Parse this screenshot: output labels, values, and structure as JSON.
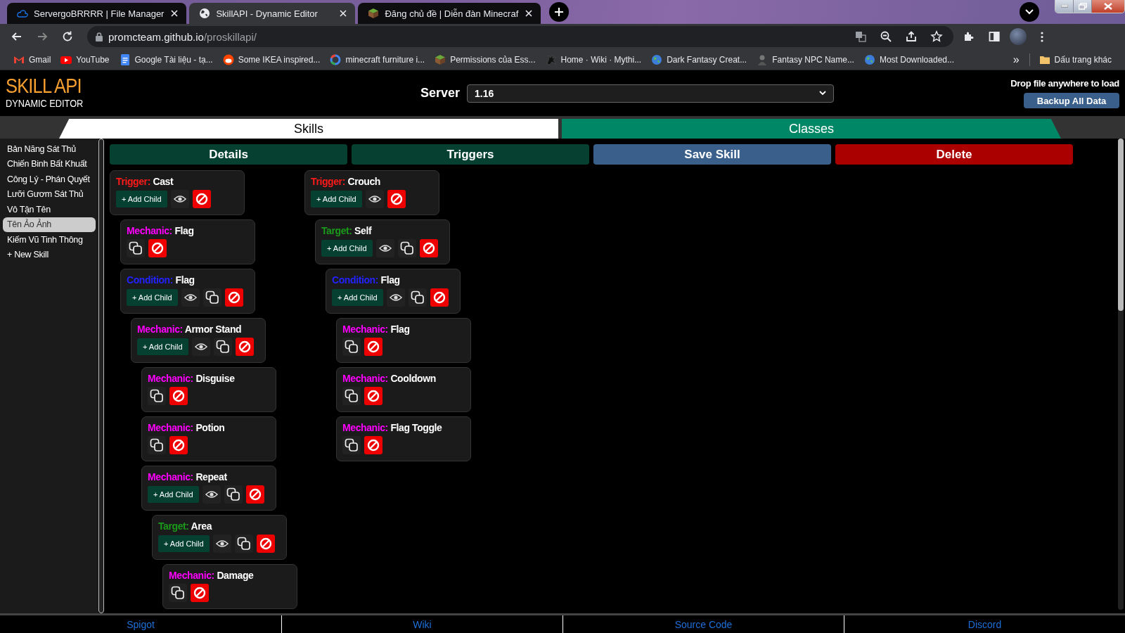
{
  "browser": {
    "tabs": [
      {
        "title": "ServergoBRRRR | File Manager",
        "selected": false
      },
      {
        "title": "SkillAPI - Dynamic Editor",
        "selected": true
      },
      {
        "title": "Đăng chủ đề | Diễn đàn Minecraf",
        "selected": false
      }
    ],
    "address": {
      "host": "promcteam.github.io",
      "path": "/proskillapi/"
    },
    "bookmarks": [
      "Gmail",
      "YouTube",
      "Google Tài liệu - tạ...",
      "Some IKEA inspired...",
      "minecraft furniture i...",
      "Permissions của Ess...",
      "Home · Wiki · Mythi...",
      "Dark Fantasy Creat...",
      "Fantasy NPC Name...",
      "Most Downloaded..."
    ],
    "overflow": "»",
    "other_bookmarks": "Dấu trang khác"
  },
  "header": {
    "logo_title": "SKILL API",
    "logo_subtitle": "DYNAMIC EDITOR",
    "server_label": "Server",
    "server_value": "1.16",
    "drop_hint": "Drop file anywhere to load",
    "backup_button": "Backup All Data"
  },
  "main_tabs": [
    {
      "label": "Skills",
      "selected": true
    },
    {
      "label": "Classes",
      "selected": false
    }
  ],
  "sidebar": {
    "items": [
      {
        "label": "Bản Năng Sát Thủ",
        "selected": false
      },
      {
        "label": "Chiến Binh Bất Khuất",
        "selected": false
      },
      {
        "label": "Công Lý - Phán Quyết",
        "selected": false
      },
      {
        "label": "Lưỡi Gươm Sát Thủ",
        "selected": false
      },
      {
        "label": "Vô Tận Tên",
        "selected": false
      },
      {
        "label": "Tên Ảo Ảnh",
        "selected": true
      },
      {
        "label": "Kiếm Vũ Tinh Thông",
        "selected": false
      }
    ],
    "new_skill": "+ New Skill"
  },
  "actions": [
    {
      "label": "Details",
      "kind": "nav"
    },
    {
      "label": "Triggers",
      "kind": "nav"
    },
    {
      "label": "Save Skill",
      "kind": "save"
    },
    {
      "label": "Delete",
      "kind": "danger"
    }
  ],
  "tree": [
    {
      "kind": "trigger",
      "label": "Trigger:",
      "name": "Cast",
      "add_child": "+ Add Child",
      "children": [
        {
          "kind": "mechanic",
          "label": "Mechanic:",
          "name": "Flag"
        },
        {
          "kind": "condition",
          "label": "Condition:",
          "name": "Flag",
          "add_child": "+ Add Child",
          "children": [
            {
              "kind": "mechanic",
              "label": "Mechanic:",
              "name": "Armor Stand",
              "add_child": "+ Add Child",
              "children": [
                {
                  "kind": "mechanic",
                  "label": "Mechanic:",
                  "name": "Disguise"
                },
                {
                  "kind": "mechanic",
                  "label": "Mechanic:",
                  "name": "Potion"
                },
                {
                  "kind": "mechanic",
                  "label": "Mechanic:",
                  "name": "Repeat",
                  "add_child": "+ Add Child",
                  "children": [
                    {
                      "kind": "target",
                      "label": "Target:",
                      "name": "Area",
                      "add_child": "+ Add Child",
                      "children": [
                        {
                          "kind": "mechanic",
                          "label": "Mechanic:",
                          "name": "Damage"
                        }
                      ]
                    }
                  ]
                }
              ]
            }
          ]
        }
      ]
    },
    {
      "kind": "trigger",
      "label": "Trigger:",
      "name": "Crouch",
      "add_child": "+ Add Child",
      "children": [
        {
          "kind": "target",
          "label": "Target:",
          "name": "Self",
          "add_child": "+ Add Child",
          "children": [
            {
              "kind": "condition",
              "label": "Condition:",
              "name": "Flag",
              "add_child": "+ Add Child",
              "children": [
                {
                  "kind": "mechanic",
                  "label": "Mechanic:",
                  "name": "Flag"
                },
                {
                  "kind": "mechanic",
                  "label": "Mechanic:",
                  "name": "Cooldown"
                },
                {
                  "kind": "mechanic",
                  "label": "Mechanic:",
                  "name": "Flag Toggle"
                }
              ]
            }
          ]
        }
      ]
    }
  ],
  "footer_links": [
    "Spigot",
    "Wiki",
    "Source Code",
    "Discord"
  ]
}
